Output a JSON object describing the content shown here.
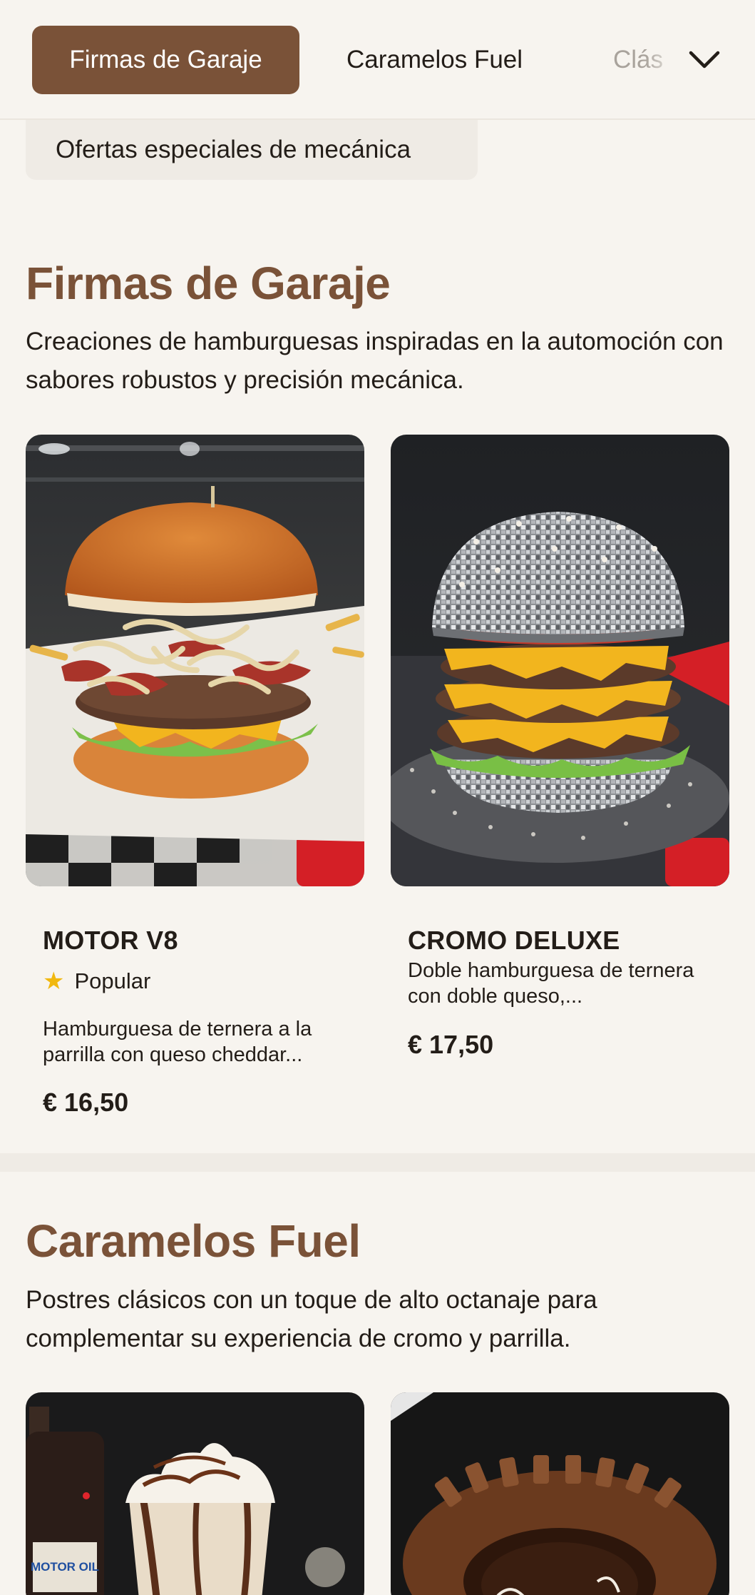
{
  "category_nav": {
    "tabs": [
      {
        "label": "Firmas de Garaje",
        "active": true
      },
      {
        "label": "Caramelos Fuel",
        "active": false
      },
      {
        "label": "Clás",
        "active": false
      }
    ],
    "expand_icon": "chevron-down-icon",
    "sub_chip": "Ofertas especiales de mecánica"
  },
  "sections": [
    {
      "title": "Firmas de Garaje",
      "description": "Creaciones de hamburguesas inspiradas en la automoción con sabores robustos y precisión mecánica.",
      "items": [
        {
          "name": "MOTOR V8",
          "badge": "Popular",
          "description": "Hamburguesa de ternera a la parrilla con queso cheddar...",
          "price": "€ 16,50"
        },
        {
          "name": "CROMO DELUXE",
          "description": "Doble hamburguesa de ternera con doble queso,...",
          "price": "€ 17,50"
        }
      ]
    },
    {
      "title": "Caramelos Fuel",
      "description": "Postres clásicos con un toque de alto octanaje para complementar su experiencia de cromo y parrilla.",
      "image_labels": [
        "MOTOR OIL"
      ]
    }
  ],
  "colors": {
    "accent": "#7a5238",
    "background": "#f7f4ef",
    "star": "#f1b80f"
  }
}
